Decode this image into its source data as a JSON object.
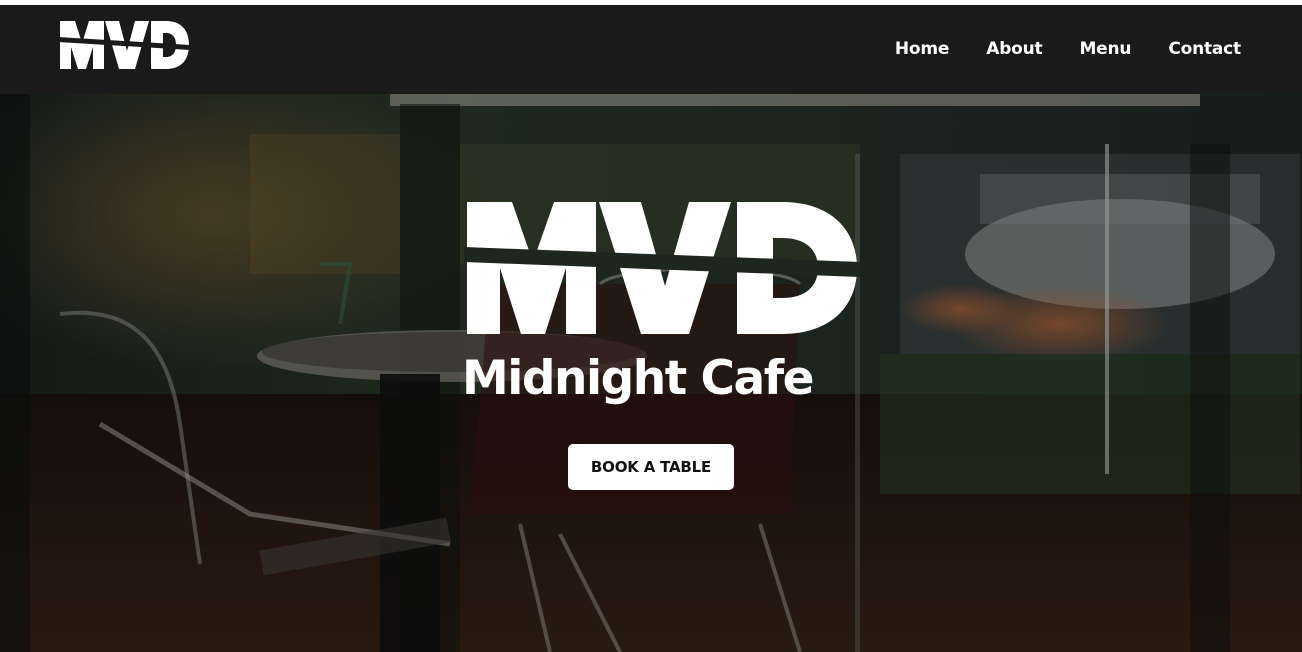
{
  "brand": {
    "logo_text": "MVD",
    "name": "Midnight Cafe"
  },
  "nav": {
    "items": [
      {
        "label": "Home"
      },
      {
        "label": "About"
      },
      {
        "label": "Menu"
      },
      {
        "label": "Contact"
      }
    ]
  },
  "hero": {
    "cta_label": "BOOK A TABLE",
    "background_description_icon": "cafe-interior-photo"
  },
  "colors": {
    "navbar_bg": "#1a1a1a",
    "text": "#ffffff",
    "button_bg": "#ffffff",
    "button_text": "#111111"
  }
}
